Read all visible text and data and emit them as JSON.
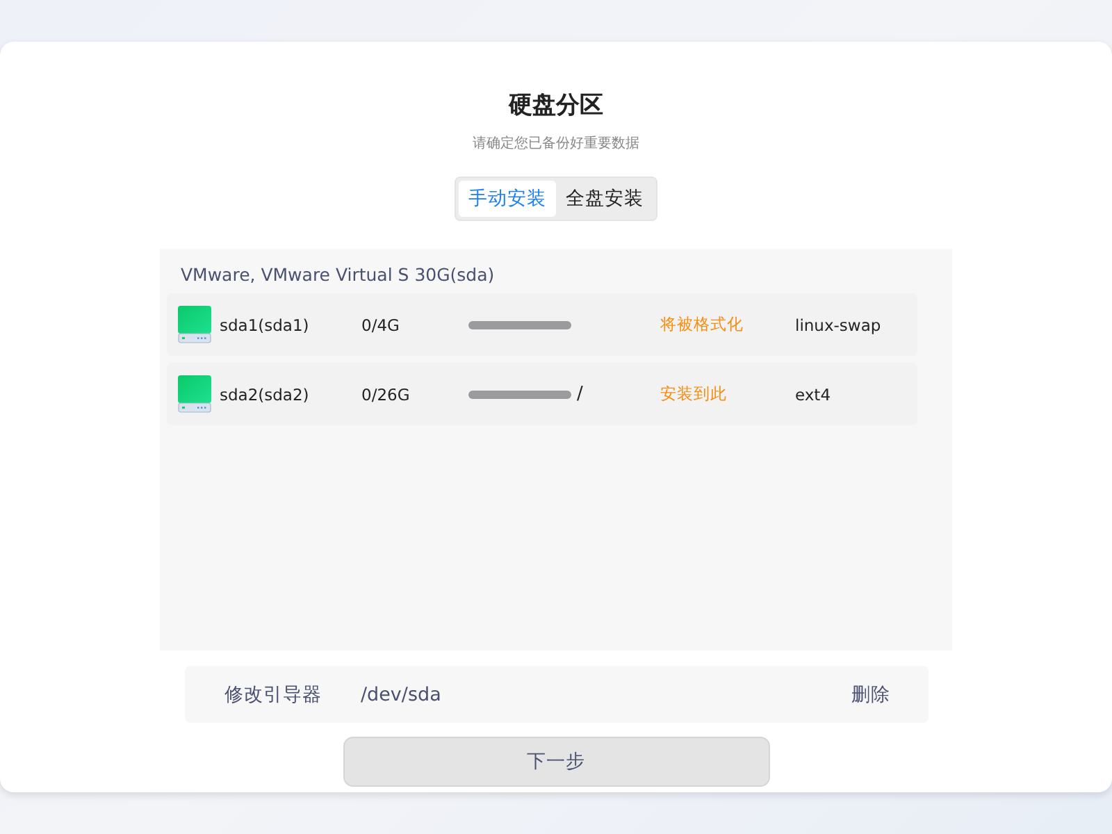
{
  "title": "硬盘分区",
  "subtitle": "请确定您已备份好重要数据",
  "tabs": [
    {
      "label": "手动安装",
      "selected": true
    },
    {
      "label": "全盘安装",
      "selected": false
    }
  ],
  "disk": {
    "name": "VMware,  VMware  Virtual  S  30G(sda)",
    "partitions": [
      {
        "name": "sda1(sda1)",
        "usage": "0/4G",
        "status": "将被格式化",
        "filesystem": "linux-swap"
      },
      {
        "name": "sda2(sda2)",
        "usage": "0/26G",
        "mount": "/",
        "status": "安装到此",
        "filesystem": "ext4"
      }
    ]
  },
  "bootloader": {
    "label": "修改引导器",
    "device": "/dev/sda",
    "action": "删除"
  },
  "next_button": "下一步"
}
